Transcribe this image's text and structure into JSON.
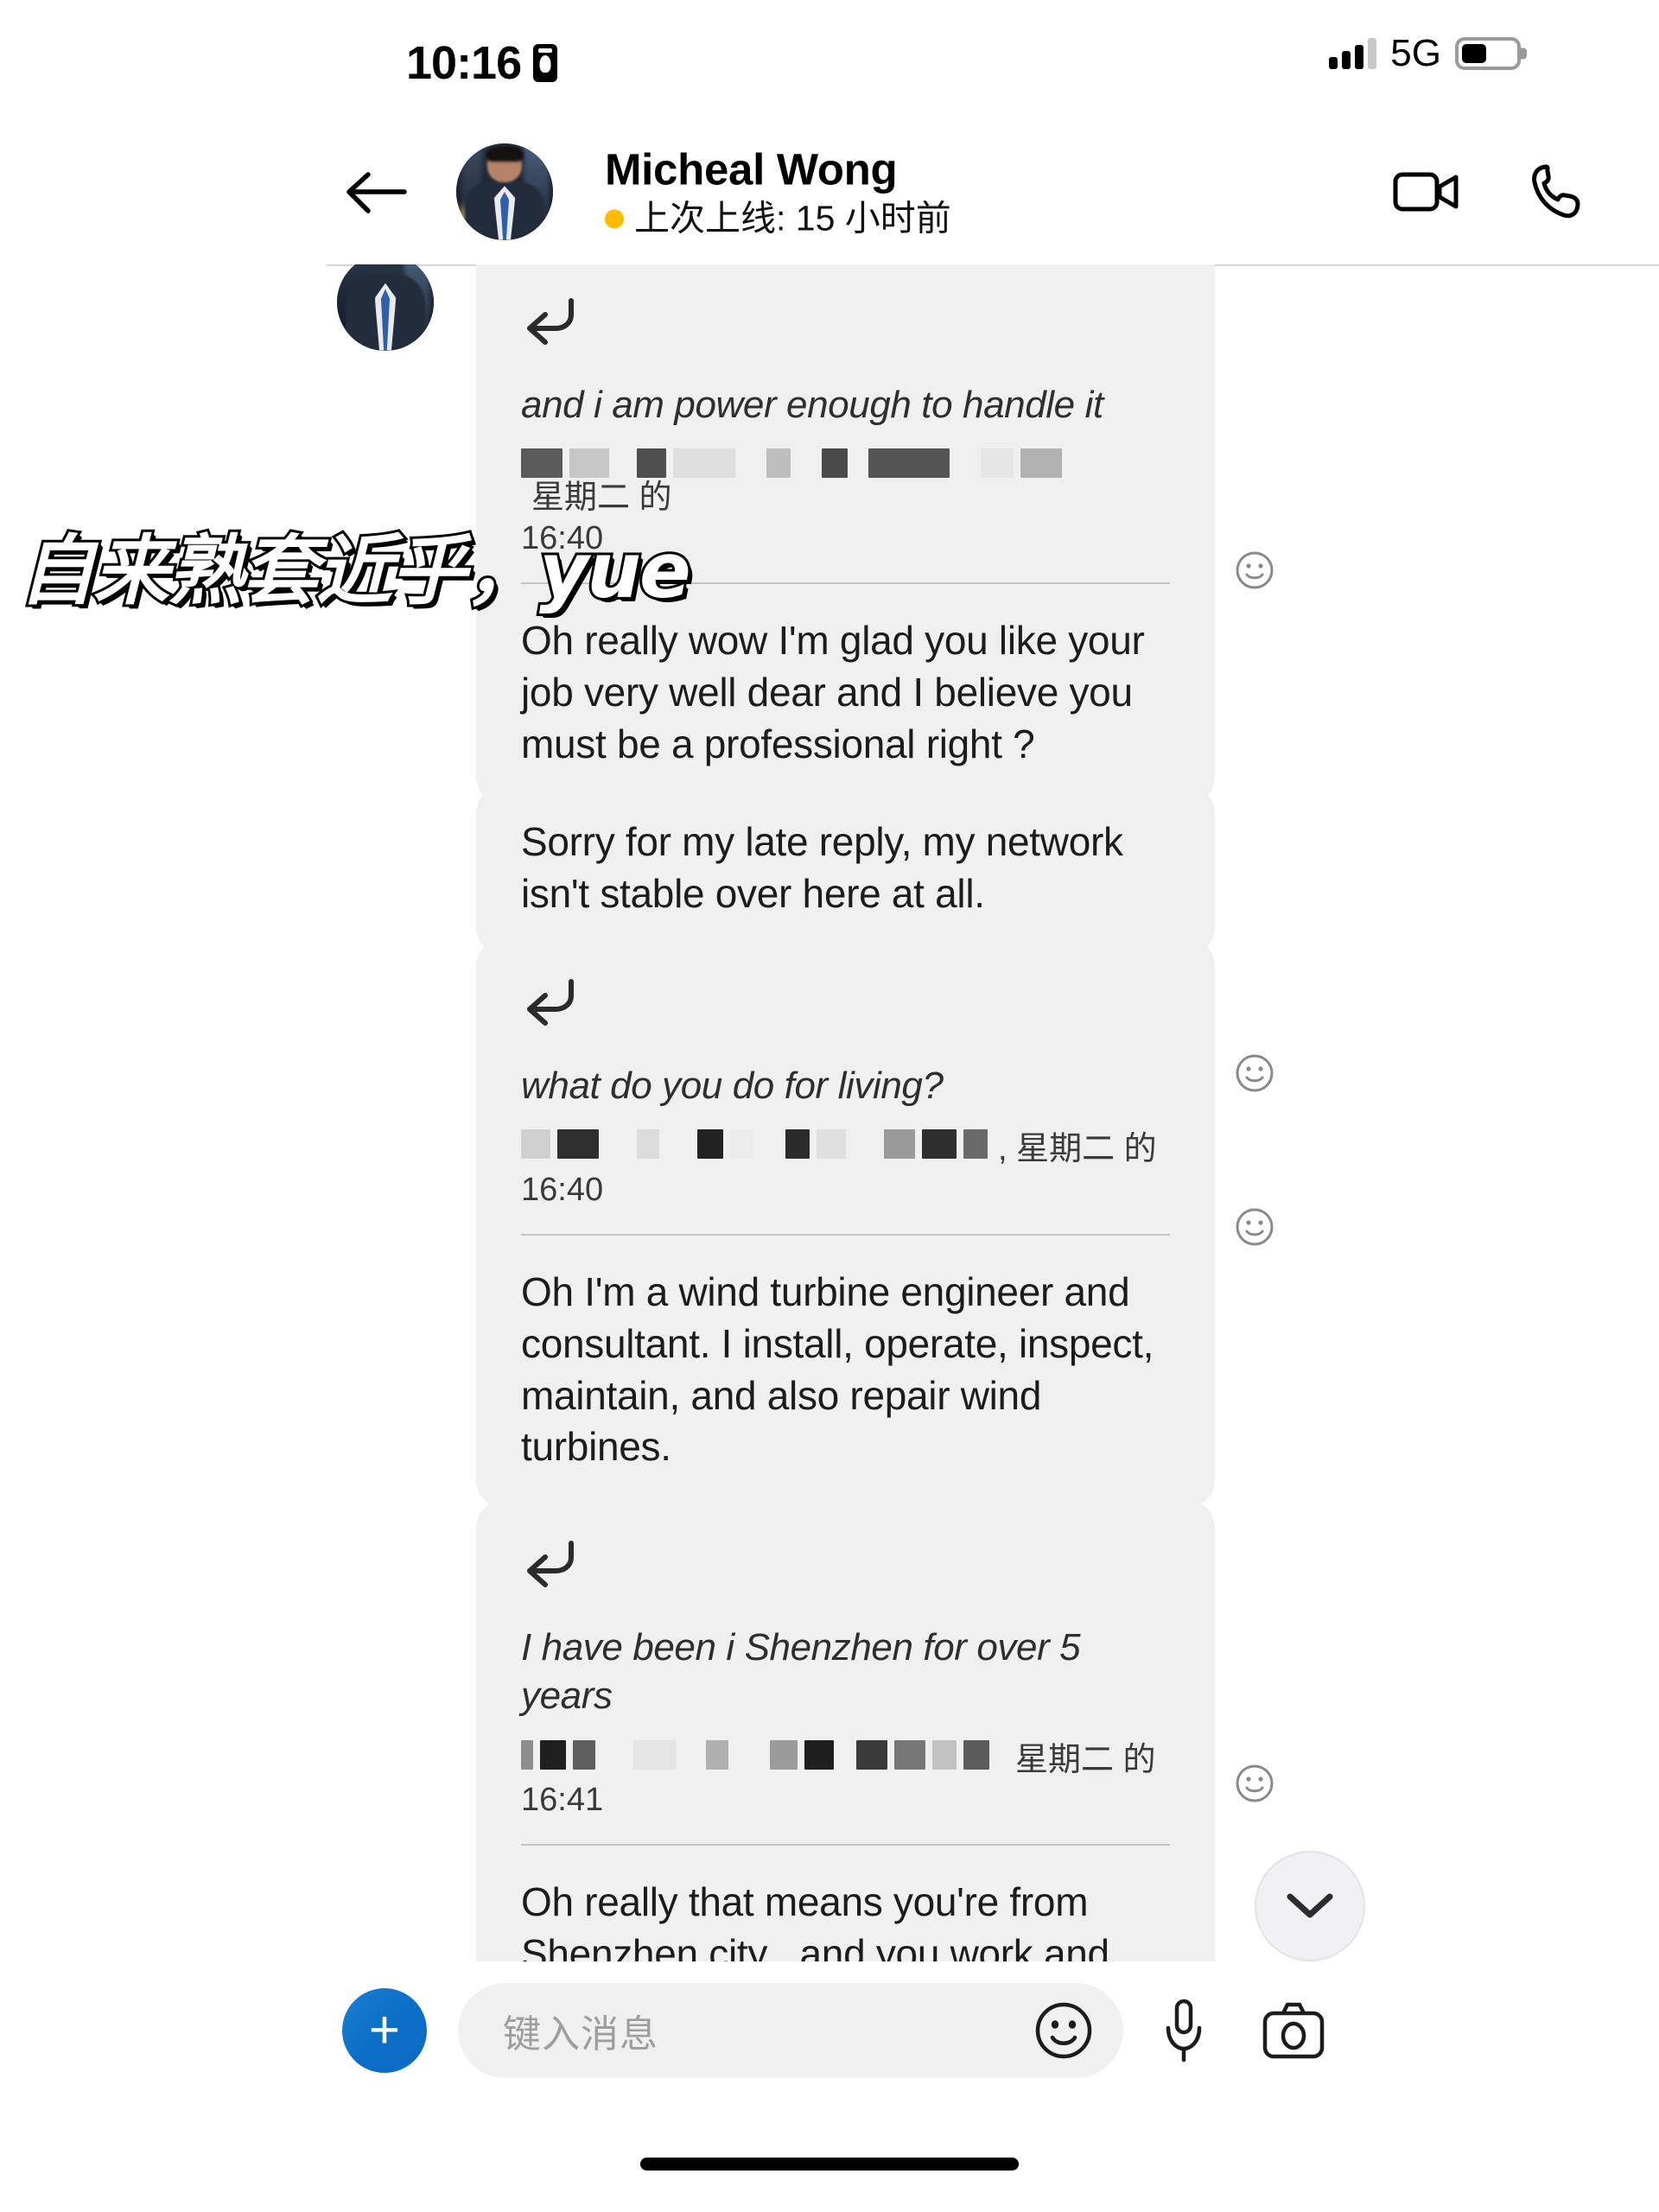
{
  "status_bar": {
    "time": "10:16",
    "lock_icon": "portrait-orientation-lock-icon",
    "network": "5G",
    "signal_icon": "signal-bars-icon",
    "battery_icon": "battery-icon",
    "battery_level_percent": 47
  },
  "header": {
    "back_icon": "back-arrow-icon",
    "avatar_alt": "contact-avatar",
    "contact_name": "Micheal Wong",
    "presence_dot_color": "#ffbb00",
    "presence_text": "上次上线: 15 小时前",
    "video_call_icon": "video-camera-icon",
    "voice_call_icon": "phone-icon"
  },
  "watermark": {
    "text": "自来熟套近乎，yue"
  },
  "messages": [
    {
      "id": "msg-quote-power",
      "type": "reply",
      "reply_icon": "reply-arrow-icon",
      "quote_text": "and i am power enough to handle it",
      "quote_sender_redacted": true,
      "quote_day": "星期二 的",
      "quote_time": "16:40",
      "body": "Oh really wow I'm glad you like your job very well dear and I believe you must be a professional right ?",
      "reaction_icon": "smiley-reaction-icon"
    },
    {
      "id": "msg-late-reply",
      "type": "plain",
      "body": "Sorry for my late reply, my network isn't stable over here at all.",
      "reaction_icon": "smiley-reaction-icon"
    },
    {
      "id": "msg-quote-living",
      "type": "reply",
      "reply_icon": "reply-arrow-icon",
      "quote_text": "what do you do for living?",
      "quote_sender_redacted": true,
      "quote_day": ", 星期二 的",
      "quote_time": "16:40",
      "body": "Oh I'm a wind turbine engineer and consultant. I install, operate, inspect, maintain, and also repair wind turbines.",
      "reaction_icon": "smiley-reaction-icon"
    },
    {
      "id": "msg-quote-shenzhen",
      "type": "reply",
      "reply_icon": "reply-arrow-icon",
      "quote_text": "I have been i Shenzhen for over 5 years",
      "quote_sender_redacted": true,
      "quote_day": "星期二 的",
      "quote_time": "16:41",
      "body": "Oh really that means you're from Shenzhen city , and you work and live there ?",
      "reaction_icon": "smiley-reaction-icon"
    }
  ],
  "scroll_button": {
    "icon": "chevron-down-icon"
  },
  "input_bar": {
    "plus_icon": "plus-icon",
    "plus_label": "+",
    "placeholder": "键入消息",
    "emoji_icon": "smiley-icon",
    "mic_icon": "microphone-icon",
    "camera_icon": "camera-icon"
  },
  "home_indicator": "home-indicator-bar",
  "colors": {
    "bubble_bg": "#f0f0f0",
    "accent_blue": "#0a6fc6",
    "presence_yellow": "#ffbb00",
    "text_primary": "#1c1c1c"
  }
}
